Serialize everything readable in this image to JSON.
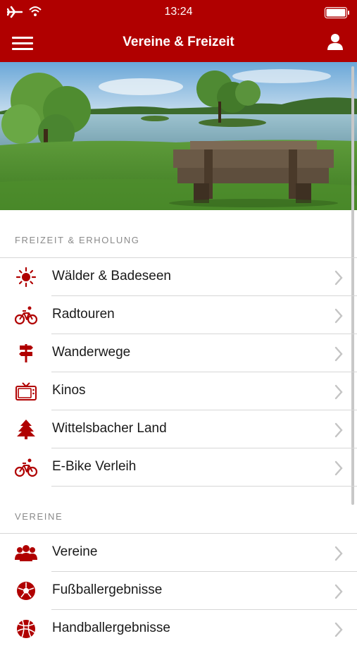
{
  "status_bar": {
    "time": "13:24"
  },
  "navbar": {
    "title": "Vereine & Freizeit",
    "menu_icon": "hamburger-menu-icon",
    "profile_icon": "user-profile-icon"
  },
  "colors": {
    "brand": "#b00000",
    "section_header": "#8a8a8a",
    "divider": "#d6d6d6",
    "chevron": "#c4c4c4"
  },
  "sections": [
    {
      "header": "FREIZEIT & ERHOLUNG",
      "items": [
        {
          "label": "Wälder & Badeseen",
          "icon": "sun-icon"
        },
        {
          "label": "Radtouren",
          "icon": "bicycle-icon"
        },
        {
          "label": "Wanderwege",
          "icon": "signpost-icon"
        },
        {
          "label": "Kinos",
          "icon": "tv-icon"
        },
        {
          "label": "Wittelsbacher Land",
          "icon": "tree-icon"
        },
        {
          "label": "E-Bike Verleih",
          "icon": "bicycle-icon"
        }
      ]
    },
    {
      "header": "VEREINE",
      "items": [
        {
          "label": "Vereine",
          "icon": "group-icon"
        },
        {
          "label": "Fußballergebnisse",
          "icon": "soccer-ball-icon"
        },
        {
          "label": "Handballergebnisse",
          "icon": "handball-icon"
        }
      ]
    }
  ]
}
